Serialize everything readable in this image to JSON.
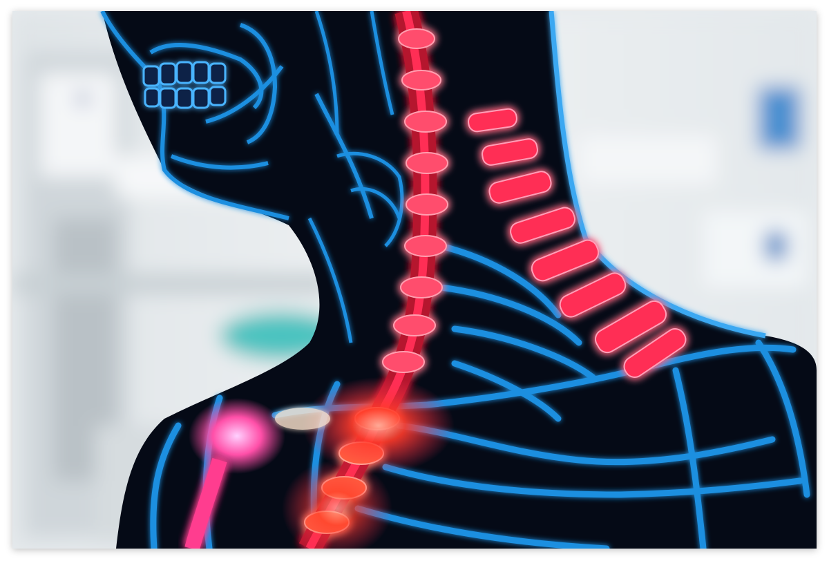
{
  "image": {
    "subject": "x-ray-neck-spine",
    "colors": {
      "background": "#e7ebee",
      "bone_blue": "#1f8fe0",
      "bone_glow": "#5fc6ff",
      "body_dark": "#050a16",
      "spine_red": "#ff2d55",
      "spine_hot": "#ff5a2a",
      "teal_equipment": "#4cc3c0"
    }
  }
}
